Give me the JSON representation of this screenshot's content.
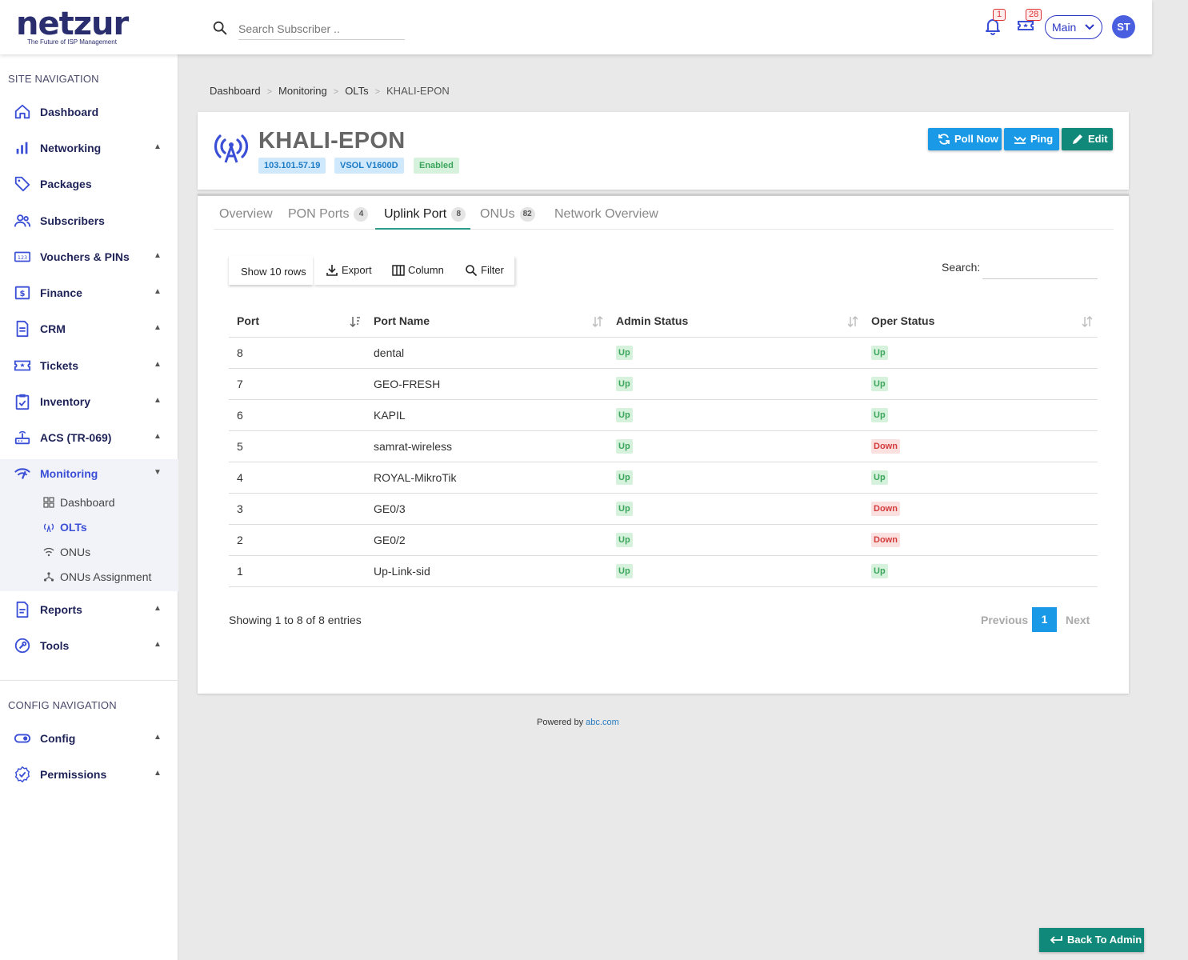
{
  "header": {
    "logo_text": "netzur",
    "logo_tagline": "The Future of ISP Management",
    "search_placeholder": "Search Subscriber ..",
    "notifications_count": "1",
    "tickets_count": "28",
    "workspace": "Main",
    "user_initials": "ST"
  },
  "sidebar": {
    "site_heading": "SITE NAVIGATION",
    "config_heading": "CONFIG NAVIGATION",
    "items": [
      {
        "label": "Dashboard",
        "icon": "home-icon"
      },
      {
        "label": "Networking",
        "icon": "bar-chart-icon"
      },
      {
        "label": "Packages",
        "icon": "tag-icon"
      },
      {
        "label": "Subscribers",
        "icon": "users-icon"
      },
      {
        "label": "Vouchers & PINs",
        "icon": "voucher-icon"
      },
      {
        "label": "Finance",
        "icon": "dollar-icon"
      },
      {
        "label": "CRM",
        "icon": "document-icon"
      },
      {
        "label": "Tickets",
        "icon": "ticket-icon"
      },
      {
        "label": "Inventory",
        "icon": "clipboard-icon"
      },
      {
        "label": "ACS (TR-069)",
        "icon": "router-icon"
      },
      {
        "label": "Monitoring",
        "icon": "wifi-signal-icon"
      },
      {
        "label": "Reports",
        "icon": "report-icon"
      },
      {
        "label": "Tools",
        "icon": "wrench-icon"
      }
    ],
    "monitoring_sub": [
      {
        "label": "Dashboard",
        "icon": "grid-icon"
      },
      {
        "label": "OLTs",
        "icon": "antenna-icon"
      },
      {
        "label": "ONUs",
        "icon": "wifi-icon"
      },
      {
        "label": "ONUs Assignment",
        "icon": "share-icon"
      }
    ],
    "config_items": [
      {
        "label": "Config",
        "icon": "toggle-icon"
      },
      {
        "label": "Permissions",
        "icon": "badge-check-icon"
      }
    ]
  },
  "breadcrumb": [
    "Dashboard",
    "Monitoring",
    "OLTs",
    "KHALI-EPON"
  ],
  "olt": {
    "name": "KHALI-EPON",
    "ip": "103.101.57.19",
    "model": "VSOL V1600D",
    "state": "Enabled",
    "actions": {
      "poll": "Poll Now",
      "ping": "Ping",
      "edit": "Edit"
    }
  },
  "tabs": [
    {
      "label": "Overview",
      "count": ""
    },
    {
      "label": "PON Ports",
      "count": "4"
    },
    {
      "label": "Uplink Port",
      "count": "8"
    },
    {
      "label": "ONUs",
      "count": "82"
    },
    {
      "label": "Network Overview",
      "count": ""
    }
  ],
  "toolbar": {
    "show_rows": "Show 10 rows",
    "export": "Export",
    "column": "Column",
    "filter": "Filter",
    "search_label": "Search:"
  },
  "table": {
    "columns": [
      "Port",
      "Port Name",
      "Admin Status",
      "Oper Status"
    ],
    "rows": [
      {
        "port": "8",
        "name": "dental",
        "admin": "Up",
        "oper": "Up"
      },
      {
        "port": "7",
        "name": "GEO-FRESH",
        "admin": "Up",
        "oper": "Up"
      },
      {
        "port": "6",
        "name": "KAPIL",
        "admin": "Up",
        "oper": "Up"
      },
      {
        "port": "5",
        "name": "samrat-wireless",
        "admin": "Up",
        "oper": "Down"
      },
      {
        "port": "4",
        "name": "ROYAL-MikroTik",
        "admin": "Up",
        "oper": "Up"
      },
      {
        "port": "3",
        "name": "GE0/3",
        "admin": "Up",
        "oper": "Down"
      },
      {
        "port": "2",
        "name": "GE0/2",
        "admin": "Up",
        "oper": "Down"
      },
      {
        "port": "1",
        "name": "Up-Link-sid",
        "admin": "Up",
        "oper": "Up"
      }
    ]
  },
  "pagination": {
    "info": "Showing 1 to 8 of 8 entries",
    "previous": "Previous",
    "current": "1",
    "next": "Next"
  },
  "footer": {
    "powered_by": "Powered by",
    "link": "abc.com"
  },
  "back_to_admin": "Back To Admin",
  "colors": {
    "primary": "#2b36c4",
    "teal": "#11897a",
    "blue": "#1a9ae6",
    "up_green": "#3aa55b",
    "down_red": "#d43b3b"
  }
}
